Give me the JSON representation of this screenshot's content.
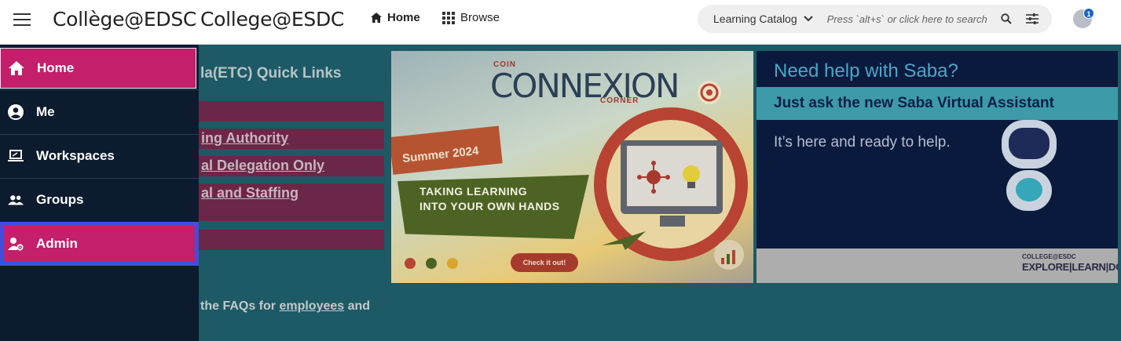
{
  "header": {
    "brand_fr": "Collège@EDSC",
    "brand_en": "College@ESDC",
    "nav": [
      {
        "label": "Home",
        "icon": "home-icon"
      },
      {
        "label": "Browse",
        "icon": "grid-icon"
      }
    ],
    "search": {
      "scope": "Learning Catalog",
      "placeholder": "Press `alt+s` or click here to search"
    },
    "notifications_count": "1"
  },
  "sidebar": {
    "items": [
      {
        "label": "Home",
        "icon": "home-icon",
        "active": true
      },
      {
        "label": "Me",
        "icon": "account-circle-icon"
      },
      {
        "label": "Workspaces",
        "icon": "laptop-icon"
      },
      {
        "label": "Groups",
        "icon": "group-icon"
      },
      {
        "label": "Admin",
        "icon": "admin-settings-icon",
        "focused": true
      }
    ]
  },
  "main": {
    "quick_links_title": "la(ETC) Quick Links",
    "quick_links": [
      "",
      "ing Authority",
      "al Delegation Only",
      "al and Staffing",
      ""
    ],
    "faq_text_before": "the FAQs for ",
    "faq_link": "employees",
    "faq_text_after": " and"
  },
  "banner_connexion": {
    "coin": "COIN",
    "title": "CONNEXION",
    "corner": "CORNER",
    "season": "Summer 2024",
    "tagline_1": "TAKING LEARNING",
    "tagline_2": "INTO YOUR OWN HANDS",
    "button": "Check it out!"
  },
  "banner_saba": {
    "heading": "Need help with Saba?",
    "ask": "Just ask the new Saba Virtual Assistant",
    "ready": "It’s here and ready to help.",
    "logo_top": "COLLEGE@ESDC",
    "logo": "EXPLORE|LEARN|DO"
  },
  "colors": {
    "sidebar_bg": "#0c1b2e",
    "accent": "#c41f6a",
    "focus_ring": "#3f4fdc",
    "content_overlay": "#1d5a66"
  }
}
